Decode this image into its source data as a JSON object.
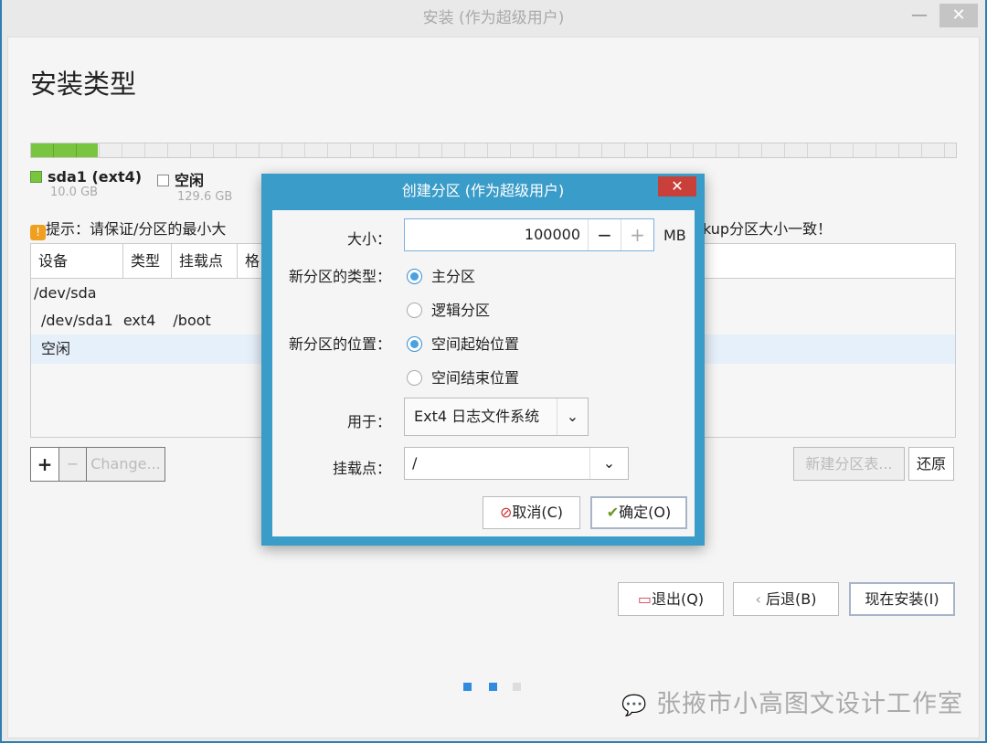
{
  "window": {
    "title": "安装 (作为超级用户)",
    "minimize": "—",
    "close": "✕"
  },
  "page": {
    "title": "安装类型"
  },
  "disk": {
    "used_fraction": 0.072,
    "colors": {
      "used": "#7ac540",
      "free": "#eeeeee"
    },
    "legend": [
      {
        "name": "sda1 (ext4)",
        "size": "10.0 GB"
      },
      {
        "name": "空闲",
        "size": "129.6 GB"
      }
    ]
  },
  "tip": {
    "icon": "warning-icon",
    "text_left": "提示：请保证/分区的最小大",
    "text_right": "kup分区大小一致！"
  },
  "table": {
    "headers": [
      "设备",
      "类型",
      "挂载点",
      "格"
    ],
    "rows": [
      {
        "device": "/dev/sda",
        "type": "",
        "mount": ""
      },
      {
        "device": "/dev/sda1",
        "type": "ext4",
        "mount": "/boot"
      },
      {
        "device": "空闲",
        "type": "",
        "mount": ""
      }
    ]
  },
  "table_buttons": {
    "add": "+",
    "remove": "−",
    "change": "Change...",
    "new_table": "新建分区表...",
    "revert": "还原"
  },
  "dialog": {
    "title": "创建分区 (作为超级用户)",
    "close": "✕",
    "size_label": "大小：",
    "size_value": "100000",
    "minus": "−",
    "plus": "+",
    "unit": "MB",
    "type_label": "新分区的类型：",
    "type_options": [
      "主分区",
      "逻辑分区"
    ],
    "type_selected": 0,
    "location_label": "新分区的位置：",
    "location_options": [
      "空间起始位置",
      "空间结束位置"
    ],
    "location_selected": 0,
    "use_label": "用于：",
    "use_value": "Ext4 日志文件系统",
    "mount_label": "挂载点：",
    "mount_value": "/",
    "cancel": "取消(C)",
    "ok": "确定(O)"
  },
  "nav": {
    "quit": "退出(Q)",
    "back": "后退(B)",
    "install": "现在安装(I)"
  },
  "steps": {
    "total": 3,
    "current": 2
  },
  "watermark": "张掖市小高图文设计工作室"
}
